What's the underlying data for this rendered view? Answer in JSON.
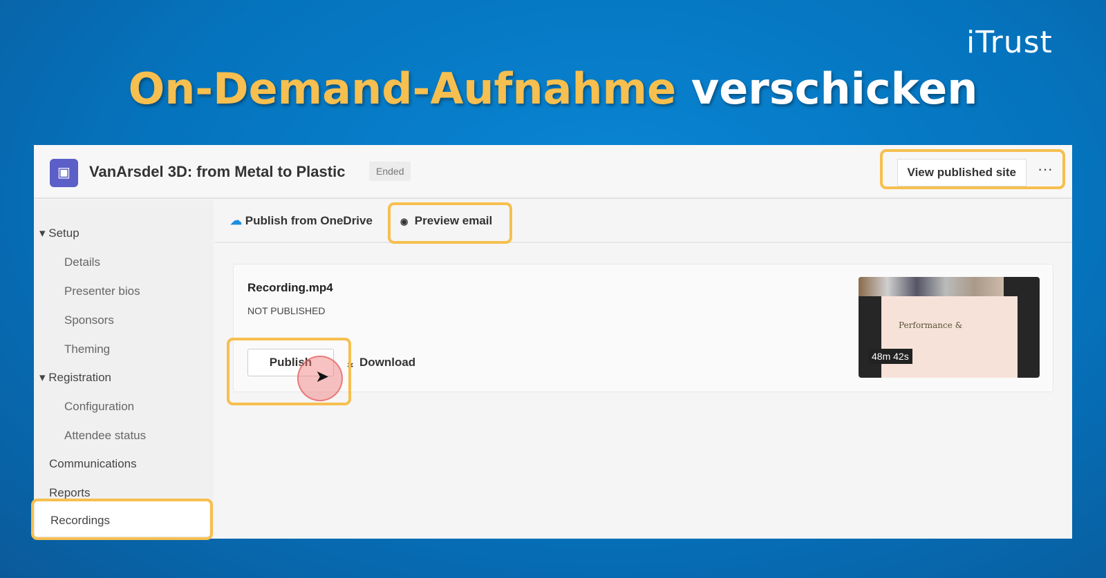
{
  "brand": {
    "logo": "iTrust"
  },
  "headline": {
    "highlight": "On-Demand-Aufnahme",
    "rest": "verschicken",
    "highlight_color": "#f6bf4f"
  },
  "window": {
    "title": "VanArsdel 3D: from Metal to Plastic",
    "status_badge": "Ended",
    "view_published_site": "View published site",
    "more": "···"
  },
  "sidebar": {
    "items": [
      {
        "label": "Setup",
        "type": "group"
      },
      {
        "label": "Details"
      },
      {
        "label": "Presenter bios"
      },
      {
        "label": "Sponsors"
      },
      {
        "label": "Theming"
      },
      {
        "label": "Registration",
        "type": "group"
      },
      {
        "label": "Configuration"
      },
      {
        "label": "Attendee status"
      },
      {
        "label": "Communications"
      },
      {
        "label": "Reports"
      },
      {
        "label": "Recordings",
        "selected": true
      }
    ]
  },
  "toolbar": {
    "publish_onedrive": "Publish from OneDrive",
    "preview_email": "Preview email"
  },
  "recording": {
    "file": "Recording.mp4",
    "status": "NOT PUBLISHED",
    "publish": "Publish",
    "download": "Download",
    "duration": "48m 42s",
    "slide_title": "Performance &"
  }
}
